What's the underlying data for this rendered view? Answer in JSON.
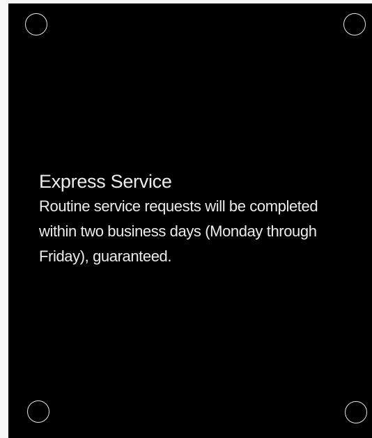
{
  "sign": {
    "title": "Express Service",
    "line_1": "Routine service requests will be completed",
    "line_2": "within two business days (Monday through",
    "line_3": "Friday), guaranteed."
  },
  "colors": {
    "panel": "#000000",
    "text": "#ececec",
    "hole_outline": "#e6e6e6",
    "background": "#f7f7f7"
  }
}
